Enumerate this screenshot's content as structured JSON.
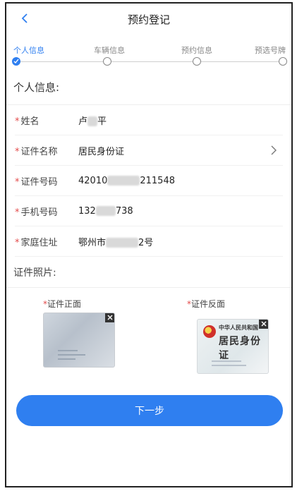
{
  "header": {
    "title": "预约登记"
  },
  "steps": [
    {
      "label": "个人信息",
      "active": true
    },
    {
      "label": "车辆信息",
      "active": false
    },
    {
      "label": "预约信息",
      "active": false
    },
    {
      "label": "预选号牌",
      "active": false
    }
  ],
  "personal": {
    "section_title": "个人信息:",
    "fields": [
      {
        "label": "姓名",
        "value_prefix": "卢",
        "value_suffix": "平"
      },
      {
        "label": "证件名称",
        "value_prefix": "居民身份证",
        "value_suffix": ""
      },
      {
        "label": "证件号码",
        "value_prefix": "42010",
        "value_suffix": "211548"
      },
      {
        "label": "手机号码",
        "value_prefix": "132",
        "value_suffix": "738"
      },
      {
        "label": "家庭住址",
        "value_prefix": "鄂州市",
        "value_suffix": "2号"
      }
    ]
  },
  "photos": {
    "section_title": "证件照片:",
    "front_label": "证件正面",
    "back_label": "证件反面",
    "back_card_small": "中华人民共和国",
    "back_card_big": "居民身份证"
  },
  "footer": {
    "next_label": "下一步"
  },
  "colors": {
    "accent": "#2f7ff0",
    "required": "#e34b4b"
  },
  "icons": {
    "back": "chevron-left-icon",
    "disclosure": "chevron-right-icon",
    "check": "check-icon",
    "close": "close-icon"
  }
}
